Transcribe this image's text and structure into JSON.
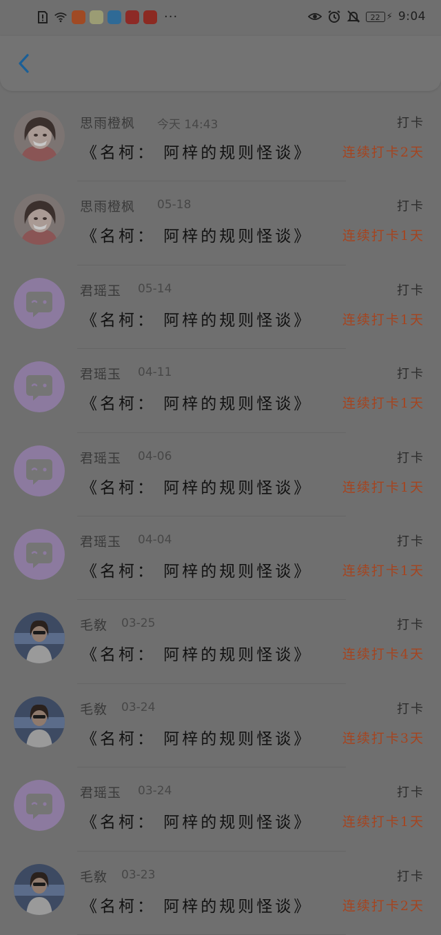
{
  "status_bar": {
    "left_icons": [
      "alert-icon",
      "wifi-icon",
      "app-taobao-icon",
      "app-qq-icon",
      "app-browser-icon",
      "app-netease-icon",
      "app-pinduoduo-icon"
    ],
    "more": "···",
    "battery": "22",
    "time": "9:04"
  },
  "header": {
    "back_icon": "chevron-left-icon"
  },
  "entries": [
    {
      "user": "思雨橙枫",
      "date": "今天 14:43",
      "book": "《名柯： 阿梓的规则怪谈》",
      "action": "打卡",
      "streak": "连续打卡2天",
      "avatar": "girl"
    },
    {
      "user": "思雨橙枫",
      "date": "05-18",
      "book": "《名柯： 阿梓的规则怪谈》",
      "action": "打卡",
      "streak": "连续打卡1天",
      "avatar": "girl"
    },
    {
      "user": "君瑶玉",
      "date": "05-14",
      "book": "《名柯： 阿梓的规则怪谈》",
      "action": "打卡",
      "streak": "连续打卡1天",
      "avatar": "default"
    },
    {
      "user": "君瑶玉",
      "date": "04-11",
      "book": "《名柯： 阿梓的规则怪谈》",
      "action": "打卡",
      "streak": "连续打卡1天",
      "avatar": "default"
    },
    {
      "user": "君瑶玉",
      "date": "04-06",
      "book": "《名柯： 阿梓的规则怪谈》",
      "action": "打卡",
      "streak": "连续打卡1天",
      "avatar": "default"
    },
    {
      "user": "君瑶玉",
      "date": "04-04",
      "book": "《名柯： 阿梓的规则怪谈》",
      "action": "打卡",
      "streak": "连续打卡1天",
      "avatar": "default"
    },
    {
      "user": "毛敎",
      "date": "03-25",
      "book": "《名柯： 阿梓的规则怪谈》",
      "action": "打卡",
      "streak": "连续打卡4天",
      "avatar": "photo"
    },
    {
      "user": "毛敎",
      "date": "03-24",
      "book": "《名柯： 阿梓的规则怪谈》",
      "action": "打卡",
      "streak": "连续打卡3天",
      "avatar": "photo"
    },
    {
      "user": "君瑶玉",
      "date": "03-24",
      "book": "《名柯： 阿梓的规则怪谈》",
      "action": "打卡",
      "streak": "连续打卡1天",
      "avatar": "default"
    },
    {
      "user": "毛敎",
      "date": "03-23",
      "book": "《名柯： 阿梓的规则怪谈》",
      "action": "打卡",
      "streak": "连续打卡2天",
      "avatar": "photo"
    }
  ],
  "colors": {
    "overlay_background": "#6f6f6f",
    "streak_text": "#a5441f",
    "back_icon": "#1a5f97",
    "default_avatar": "#8c7a9f"
  }
}
